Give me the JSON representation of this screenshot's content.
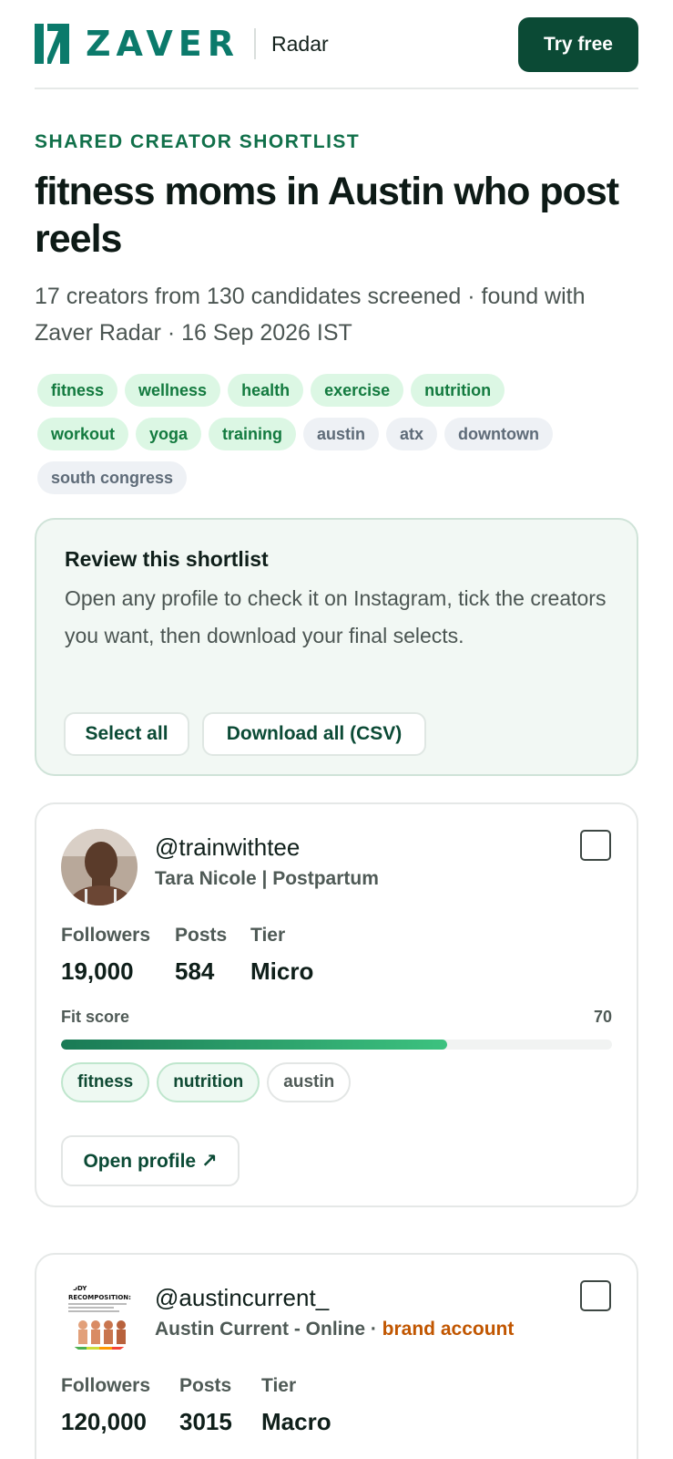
{
  "header": {
    "brand": "ZAVER",
    "product": "Radar",
    "cta": "Try free",
    "logo_icon": "zaver-logo-icon"
  },
  "page": {
    "eyebrow": "SHARED CREATOR SHORTLIST",
    "title": "fitness moms in Austin who post reels",
    "meta": "17 creators from 130 candidates screened · found with Zaver Radar · 16 Sep 2026 IST"
  },
  "tags": [
    {
      "label": "fitness",
      "kind": "green"
    },
    {
      "label": "wellness",
      "kind": "green"
    },
    {
      "label": "health",
      "kind": "green"
    },
    {
      "label": "exercise",
      "kind": "green"
    },
    {
      "label": "nutrition",
      "kind": "green"
    },
    {
      "label": "workout",
      "kind": "green"
    },
    {
      "label": "yoga",
      "kind": "green"
    },
    {
      "label": "training",
      "kind": "green"
    },
    {
      "label": "austin",
      "kind": "gray"
    },
    {
      "label": "atx",
      "kind": "gray"
    },
    {
      "label": "downtown",
      "kind": "gray"
    },
    {
      "label": "south congress",
      "kind": "gray"
    }
  ],
  "review": {
    "heading": "Review this shortlist",
    "body": "Open any profile to check it on Instagram, tick the creators you want, then download your final selects.",
    "select_all": "Select all",
    "download": "Download all (CSV)"
  },
  "stats_labels": {
    "followers": "Followers",
    "posts": "Posts",
    "tier": "Tier",
    "fit": "Fit score"
  },
  "creators": [
    {
      "handle": "@trainwithtee",
      "name": "Tara Nicole | Postpartum",
      "followers": "19,000",
      "posts": "584",
      "tier": "Micro",
      "fit_score": "70",
      "fit_fraction": 0.7,
      "tags": [
        "fitness",
        "nutrition",
        "austin"
      ],
      "open_label": "Open profile ↗"
    },
    {
      "handle": "@austincurrent_",
      "name": "Austin Current - Online",
      "separator": " · ",
      "badge": "brand account",
      "followers": "120,000",
      "posts": "3015",
      "tier": "Macro",
      "avatar_text_1": "ODY",
      "avatar_text_2": "RECOMPOSITION:",
      "avatar_text_3": "A PRACTICAL GUIDE TO LOSING BODY FAT & GAINING MUSCLE SIMULTANEOUSLY"
    }
  ],
  "colors": {
    "accent": "#0b4a35",
    "brand_teal": "#0b7a6b",
    "tag_green_bg": "#dcf7e4",
    "brand_account": "#c15600"
  }
}
